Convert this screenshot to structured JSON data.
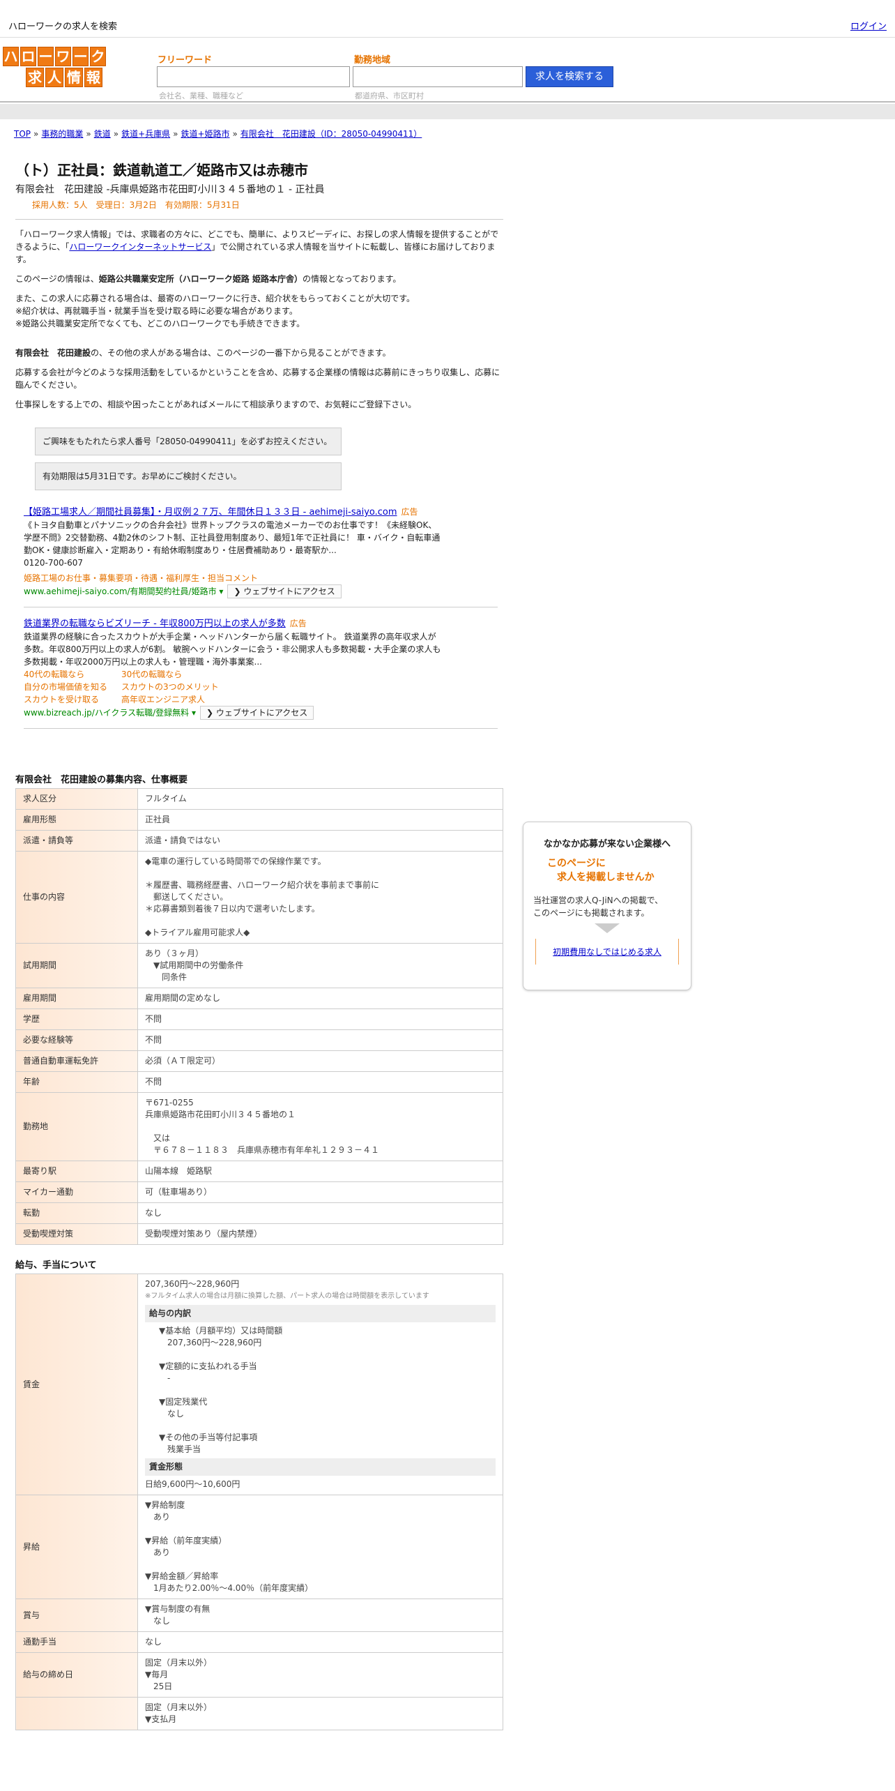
{
  "header": {
    "site_title": "ハローワークの求人を検索",
    "login": "ログイン"
  },
  "logo": {
    "row1": [
      "ハ",
      "ロ",
      "ー",
      "ワ",
      "ー",
      "ク"
    ],
    "row2": [
      "求",
      "人",
      "情",
      "報"
    ]
  },
  "search": {
    "freeword_label": "フリーワード",
    "freeword_placeholder": "",
    "freeword_hint": "会社名、業種、職種など",
    "area_label": "勤務地域",
    "area_placeholder": "",
    "area_hint": "都道府県、市区町村",
    "button_label": "求人を検索する"
  },
  "breadcrumb": [
    {
      "label": "TOP"
    },
    {
      "label": "事務的職業"
    },
    {
      "label": "鉄道"
    },
    {
      "label": "鉄道+兵庫県"
    },
    {
      "label": "鉄道+姫路市"
    },
    {
      "label": "有限会社　花田建設（ID：28050-04990411）"
    }
  ],
  "breadcrumb_sep": "»",
  "job": {
    "title": "（ト）正社員：鉄道軌道工／姫路市又は赤穂市",
    "company_line": "有限会社　花田建設 -兵庫県姫路市花田町小川３４５番地の１ - 正社員",
    "meta": "採用人数：5人　受理日：3月2日　有効期限：5月31日"
  },
  "intro": {
    "p1_a": "「ハローワーク求人情報」では、求職者の方々に、どこでも、簡単に、よりスピーディに、お探しの求人情報を提供することができるように、「",
    "p1_link": "ハローワークインターネットサービス",
    "p1_b": "」で公開されている求人情報を当サイトに転載し、皆様にお届けしております。",
    "p2_a": "このページの情報は、",
    "p2_b": "姫路公共職業安定所（ハローワーク姫路 姫路本庁舎）",
    "p2_c": "の情報となっております。",
    "p3_l1": "また、この求人に応募される場合は、最寄のハローワークに行き、紹介状をもらっておくことが大切です。",
    "p3_l2": "※紹介状は、再就職手当・就業手当を受け取る時に必要な場合があります。",
    "p3_l3": "※姫路公共職業安定所でなくても、どこのハローワークでも手続きできます。",
    "p4_a": "有限会社　花田建設",
    "p4_b": "の、その他の求人がある場合は、このページの一番下から見ることができます。",
    "p5": "応募する会社が今どのような採用活動をしているかということを含め、応募する企業様の情報は応募前にきっちり収集し、応募に臨んでください。",
    "p6": "仕事探しをする上での、相談や困ったことがあればメールにて相談承りますので、お気軽にご登録下さい。",
    "notice1": "ご興味をもたれたら求人番号「28050-04990411」を必ずお控えください。",
    "notice2": "有効期限は5月31日です。お早めにご検討ください。"
  },
  "ads": [
    {
      "title": "【姫路工場求人／期間社員募集】・月収例２７万、年間休日１３３日 - aehimeji-saiyo.com",
      "tag": "広告",
      "body": "《トヨタ自動車とパナソニックの合弁会社》世界トップクラスの電池メーカーでのお仕事です！《未経験OK、学歴不問》2交替勤務、4勤2休のシフト制、正社員登用制度あり、最短1年で正社員に！ 車・バイク・自転車通勤OK・健康診断雇入・定期あり・有給休暇制度あり・住居費補助あり・最寄駅か...",
      "phone": "0120-700-607",
      "sub": "姫路工場のお仕事・募集要項・待遇・福利厚生・担当コメント",
      "url": "www.aehimeji-saiyo.com/有期間契約社員/姫路市",
      "visit": "❯ ウェブサイトにアクセス"
    },
    {
      "title": "鉄道業界の転職ならビズリーチ - 年収800万円以上の求人が多数",
      "tag": "広告",
      "body": "鉄道業界の経験に合ったスカウトが大手企業・ヘッドハンターから届く転職サイト。 鉄道業界の高年収求人が多数。年収800万円以上の求人が6割。 敏腕ヘッドハンターに会う・非公開求人も多数掲載・大手企業の求人も多数掲載・年収2000万円以上の求人も・管理職・海外事業案...",
      "sublinks": [
        "40代の転職なら",
        "30代の転職なら",
        "自分の市場価値を知る",
        "スカウトの3つのメリット",
        "スカウトを受け取る",
        "高年収エンジニア求人"
      ],
      "url": "www.bizreach.jp/ハイクラス転職/登録無料",
      "visit": "❯ ウェブサイトにアクセス"
    }
  ],
  "overview": {
    "heading": "有限会社　花田建設の募集内容、仕事概要",
    "rows": [
      {
        "k": "求人区分",
        "v": [
          "フルタイム"
        ]
      },
      {
        "k": "雇用形態",
        "v": [
          "正社員"
        ]
      },
      {
        "k": "派遣・請負等",
        "v": [
          "派遣・請負ではない"
        ]
      },
      {
        "k": "仕事の内容",
        "v": [
          "◆電車の運行している時間帯での保線作業です。",
          "",
          "＊履歴書、職務経歴書、ハローワーク紹介状を事前まで事前に",
          "　郵送してください。",
          "＊応募書類到着後７日以内で選考いたします。",
          "",
          "◆トライアル雇用可能求人◆"
        ]
      },
      {
        "k": "試用期間",
        "v": [
          "あり（３ヶ月）",
          "　▼試用期間中の労働条件",
          "　　同条件"
        ]
      },
      {
        "k": "雇用期間",
        "v": [
          "雇用期間の定めなし"
        ]
      },
      {
        "k": "学歴",
        "v": [
          "不問"
        ]
      },
      {
        "k": "必要な経験等",
        "v": [
          "不問"
        ]
      },
      {
        "k": "普通自動車運転免許",
        "v": [
          "必須（ＡＴ限定可）"
        ]
      },
      {
        "k": "年齢",
        "v": [
          "不問"
        ]
      },
      {
        "k": "勤務地",
        "v": [
          "〒671-0255",
          "兵庫県姫路市花田町小川３４５番地の１",
          "",
          "　又は",
          "　〒６７８－１１８３　兵庫県赤穂市有年牟礼１２９３－４１"
        ]
      },
      {
        "k": "最寄り駅",
        "v": [
          "山陽本線　姫路駅"
        ]
      },
      {
        "k": "マイカー通勤",
        "v": [
          "可（駐車場あり）"
        ]
      },
      {
        "k": "転勤",
        "v": [
          "なし"
        ]
      },
      {
        "k": "受動喫煙対策",
        "v": [
          "受動喫煙対策あり（屋内禁煙）"
        ]
      }
    ]
  },
  "pay": {
    "heading": "給与、手当について",
    "wage_label": "賃金",
    "wage_range": "207,360円〜228,960円",
    "wage_note": "※フルタイム求人の場合は月額に換算した額、パート求人の場合は時間額を表示しています",
    "breakdown_head": "給与の内訳",
    "breakdown": [
      "▼基本給（月額平均）又は時間額",
      "　207,360円〜228,960円",
      "",
      "▼定額的に支払われる手当",
      "　-",
      "",
      "▼固定残業代",
      "　なし",
      "",
      "▼その他の手当等付記事項",
      "　残業手当"
    ],
    "form_head": "賃金形態",
    "form_value": "日給9,600円〜10,600円",
    "raise_label": "昇給",
    "raise": [
      "▼昇給制度",
      "　あり",
      "",
      "▼昇給（前年度実績）",
      "　あり",
      "",
      "▼昇給金額／昇給率",
      "　1月あたり2.00％〜4.00％（前年度実績）"
    ],
    "bonus_label": "賞与",
    "bonus": [
      "▼賞与制度の有無",
      "　なし"
    ],
    "commute_label": "通勤手当",
    "commute": [
      "なし"
    ],
    "closing_label": "給与の締め日",
    "closing": [
      "固定（月末以外）",
      "▼毎月",
      "　25日"
    ],
    "payday_label": "",
    "payday": [
      "固定（月末以外）",
      "▼支払月"
    ]
  },
  "sidebox": {
    "title": "なかなか応募が来ない企業様へ",
    "catch_l1": "このページに",
    "catch_l2": "　求人を掲載しませんか",
    "text_l1": "当社運営の求人Q-JiNへの掲載で、",
    "text_l2": "このページにも掲載されます。",
    "link": "初期費用なしではじめる求人"
  }
}
